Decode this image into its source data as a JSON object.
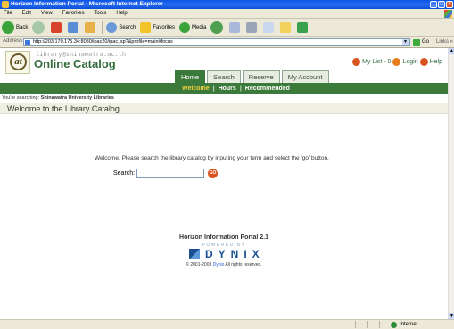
{
  "window": {
    "title": "Horizon Information Portal - Microsoft Internet Explorer",
    "buttons": [
      "_",
      "□",
      "×"
    ]
  },
  "menubar": [
    "File",
    "Edit",
    "View",
    "Favorites",
    "Tools",
    "Help"
  ],
  "toolbar": {
    "back": "Back",
    "search": "Search",
    "favorites": "Favorites",
    "media": "Media"
  },
  "address": {
    "label": "Address",
    "url": "http://203.170.175.34:8080/ipac20/ipac.jsp?&profile=main#focus",
    "go": "Go",
    "links": "Links »"
  },
  "page": {
    "logo_letter": "at",
    "email": "library@shinawatra.ac.th",
    "catalog_title": "Online Catalog",
    "top_links": {
      "mylist": "My List - 0",
      "login": "Login",
      "help": "Help"
    },
    "tabs": [
      "Home",
      "Search",
      "Reserve",
      "My Account"
    ],
    "active_tab": "Home",
    "subnav": [
      "Welcome",
      "Hours",
      "Recommended"
    ],
    "searching_prefix": "You're searching:",
    "searching_library": "Shinawatra University Libraries",
    "welcome_title": "Welcome to the Library Catalog",
    "welcome_text": "Welcome. Please search the library catalog by inputing your term and select the 'go' button.",
    "search_label": "Search:",
    "search_value": "",
    "go_label": "GO",
    "portal_name": "Horizon Information Portal 2.1",
    "powered_by": "POWERED BY",
    "vendor": "DYNIX",
    "copyright_prefix": "© 2001-2003",
    "copyright_link": "Dynix",
    "copyright_suffix": "All rights reserved."
  },
  "statusbar": {
    "zone": "Internet"
  },
  "colors": {
    "header_green": "#3c7a3c",
    "title_green": "#326c3b",
    "active_subnav": "#f2d13c",
    "go_orange": "#d9531e"
  }
}
